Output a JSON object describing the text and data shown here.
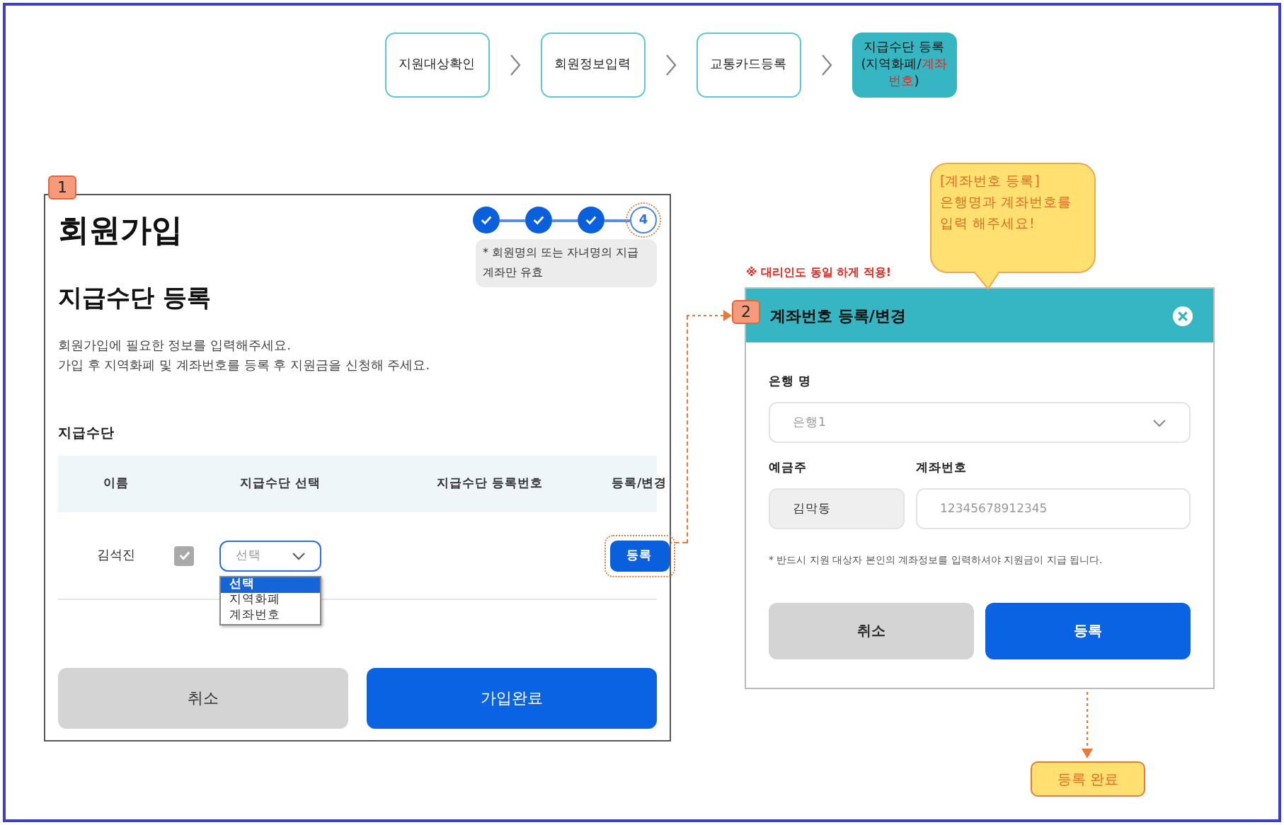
{
  "flow_steps": [
    {
      "parts": [
        {
          "text": "지원대상확인",
          "highlight": false
        }
      ],
      "selected": false
    },
    {
      "parts": [
        {
          "text": "회원정보입력",
          "highlight": false
        }
      ],
      "selected": false
    },
    {
      "parts": [
        {
          "text": "교통카드등록",
          "highlight": false
        }
      ],
      "selected": false
    },
    {
      "parts": [
        {
          "text": "지급수단 등록 (지역화폐/",
          "highlight": false
        },
        {
          "text": "계좌번호",
          "highlight": true
        },
        {
          "text": ")",
          "highlight": false
        }
      ],
      "selected": true
    }
  ],
  "signup_panel": {
    "badge": "1",
    "title": "회원가입",
    "stepper": [
      {
        "done": true,
        "annotated": false
      },
      {
        "done": true,
        "annotated": false
      },
      {
        "done": true,
        "annotated": false
      },
      {
        "done": false,
        "label": "4",
        "annotated": true
      }
    ],
    "stepper_note": "* 회원명의 또는 자녀명의 지급계좌만 유효",
    "subtitle": "지급수단 등록",
    "description": [
      "회원가입에 필요한 정보를 입력해주세요.",
      "가입 후 지역화폐 및 계좌번호를 등록 후 지원금을 신청해 주세요."
    ],
    "section_label": "지급수단",
    "table": {
      "columns": [
        "이름",
        "지급수단 선택",
        "지급수단 등록번호",
        "등록/변경"
      ],
      "rows": [
        {
          "name": "김석진",
          "checked": true,
          "select_value": "선택",
          "options": [
            {
              "label": "선택",
              "selected": true
            },
            {
              "label": "지역화폐",
              "selected": false
            },
            {
              "label": "계좌번호",
              "selected": false
            }
          ],
          "button": "등록",
          "annotated": true
        }
      ]
    },
    "buttons": [
      {
        "label": "취소",
        "kind": "secondary"
      },
      {
        "label": "가입완료",
        "kind": "primary"
      }
    ]
  },
  "proxy_note": "※ 대리인도 동일 하게 적용!",
  "callout": [
    "[계좌번호 등록]",
    "은행명과 계좌번호를",
    "입력 해주세요!"
  ],
  "account_dialog": {
    "badge": "2",
    "title": "계좌번호 등록/변경",
    "bank_label": "은행 명",
    "bank_value": "은행1",
    "holder_label": "예금주",
    "holder_value": "김막동",
    "account_label": "계좌번호",
    "account_placeholder": "12345678912345",
    "notice": "* 반드시 지원 대상자 본인의 계좌정보를 입력하셔야 지원금이 지급 됩니다.",
    "buttons": [
      {
        "label": "취소",
        "kind": "secondary"
      },
      {
        "label": "등록",
        "kind": "primary"
      }
    ]
  },
  "result_tag": "등록 완료"
}
